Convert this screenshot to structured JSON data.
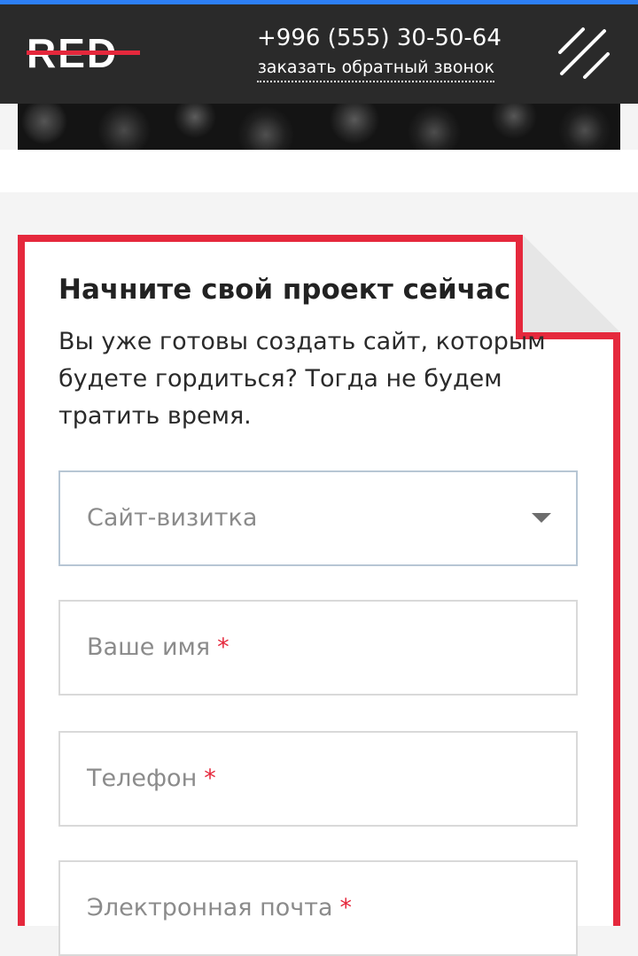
{
  "header": {
    "logo": "RED",
    "phone": "+996 (555) 30-50-64",
    "callback_link": "заказать обратный звонок",
    "menu_icon": "menu-slashes-icon"
  },
  "form": {
    "title": "Начните свой проект сейчас",
    "description": "Вы уже готовы создать сайт, которым будете гордиться? Тогда не будем тратить время.",
    "site_type_select": {
      "value": "Сайт-визитка",
      "icon": "chevron-down-icon"
    },
    "fields": [
      {
        "placeholder": "Ваше имя",
        "required_mark": "*"
      },
      {
        "placeholder": "Телефон",
        "required_mark": "*"
      },
      {
        "placeholder": "Электронная почта",
        "required_mark": "*"
      }
    ]
  },
  "colors": {
    "accent": "#e5283c",
    "header_bg": "#2a2a2a",
    "top_stripe": "#2d7ff5",
    "page_bg": "#f4f4f4"
  }
}
